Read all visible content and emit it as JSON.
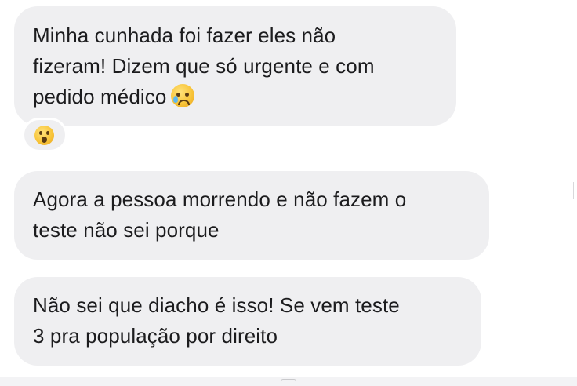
{
  "messages": [
    {
      "id": "bubble1",
      "text": "Minha cunhada foi fazer eles não\nfizeram! Dizem que só urgente e com\npedido médico",
      "trailing_emoji": "crying-face-emoji",
      "reaction": "astonished-face-emoji"
    },
    {
      "id": "bubble2",
      "text": "Agora a pessoa morrendo e não fazem o\nteste não sei porque"
    },
    {
      "id": "bubble3",
      "text": "Não sei que diacho é isso! Se vem teste\n3 pra população por direito"
    }
  ],
  "colors": {
    "bubble_background": "#efeff1",
    "text": "#1c1c1e",
    "page_background": "#ffffff"
  }
}
